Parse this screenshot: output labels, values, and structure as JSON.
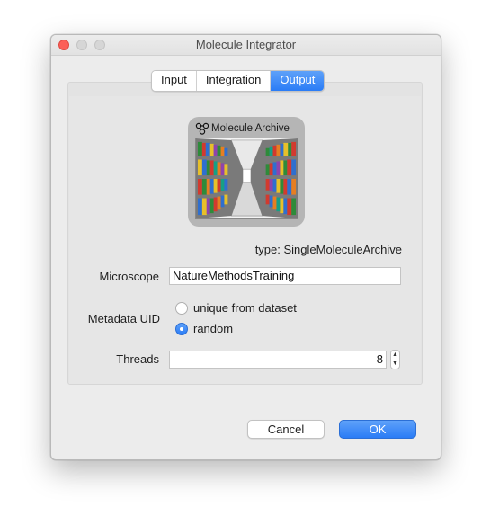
{
  "window": {
    "title": "Molecule Integrator"
  },
  "tabs": [
    {
      "label": "Input",
      "active": false
    },
    {
      "label": "Integration",
      "active": false
    },
    {
      "label": "Output",
      "active": true
    }
  ],
  "archive": {
    "label": "Molecule Archive",
    "icon": "molecule-icon",
    "image": "bookshelves-corridor"
  },
  "type_text": "type: SingleMoleculeArchive",
  "microscope": {
    "label": "Microscope",
    "value": "NatureMethodsTraining"
  },
  "metadata_uid": {
    "label": "Metadata UID",
    "options": [
      {
        "label": "unique from dataset",
        "selected": false
      },
      {
        "label": "random",
        "selected": true
      }
    ]
  },
  "threads": {
    "label": "Threads",
    "value": "8"
  },
  "buttons": {
    "cancel": "Cancel",
    "ok": "OK"
  },
  "colors": {
    "accent": "#2a7cf6",
    "close": "#fc5f57",
    "window_bg": "#ececec"
  }
}
